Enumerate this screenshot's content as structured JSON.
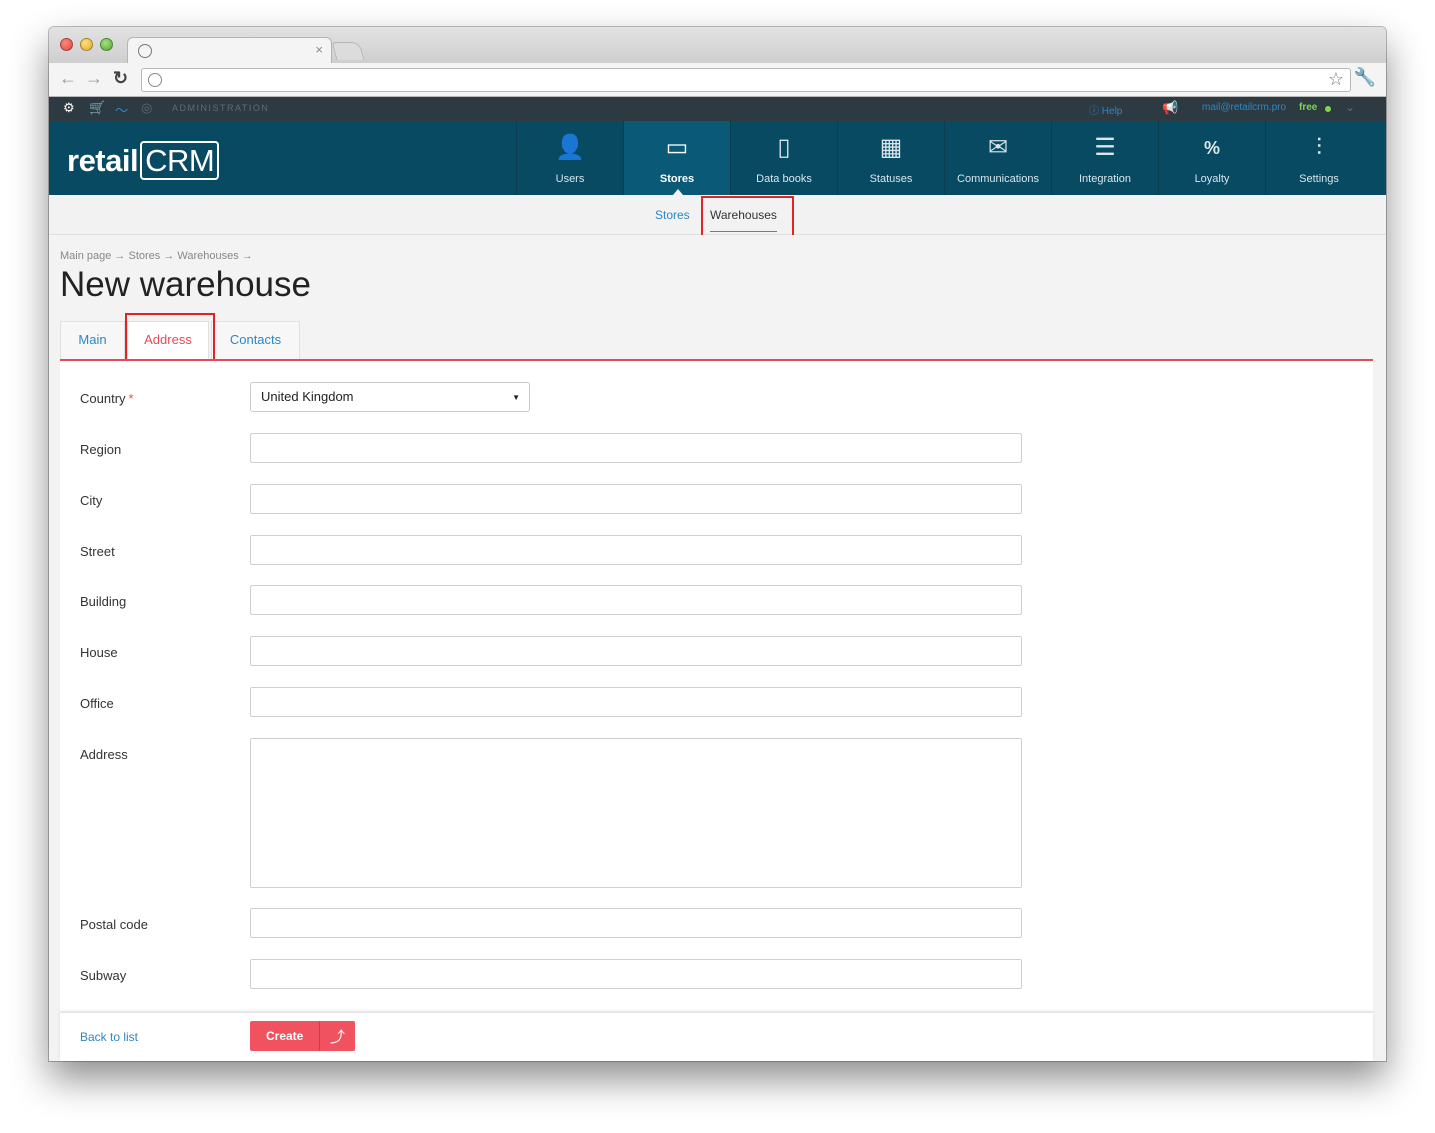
{
  "browser": {
    "tab_close": "×",
    "back_glyph": "←",
    "forward_glyph": "→",
    "reload_glyph": "↻",
    "star_glyph": "☆",
    "wrench_glyph": "🔧"
  },
  "adminbar": {
    "label": "ADMINISTRATION",
    "help": "Help",
    "email": "mail@retailcrm.pro",
    "plan": "free",
    "icons": [
      "gear-icon",
      "cart-icon",
      "chart-icon",
      "target-icon"
    ]
  },
  "logo": {
    "retail": "retail",
    "crm": "CRM"
  },
  "nav": [
    {
      "label": "Users",
      "icon": "👤"
    },
    {
      "label": "Stores",
      "icon": "▭"
    },
    {
      "label": "Data books",
      "icon": "▯"
    },
    {
      "label": "Statuses",
      "icon": "▦"
    },
    {
      "label": "Communications",
      "icon": "✉"
    },
    {
      "label": "Integration",
      "icon": "☰"
    },
    {
      "label": "Loyalty",
      "icon": "%"
    },
    {
      "label": "Settings",
      "icon": "⫶"
    }
  ],
  "subnav": {
    "stores": "Stores",
    "warehouses": "Warehouses"
  },
  "breadcrumb": "Main page → Stores → Warehouses →",
  "page_title": "New warehouse",
  "tabs": {
    "main": "Main",
    "address": "Address",
    "contacts": "Contacts"
  },
  "form": {
    "country_label": "Country",
    "required_mark": "*",
    "country_value": "United Kingdom",
    "region_label": "Region",
    "city_label": "City",
    "street_label": "Street",
    "building_label": "Building",
    "house_label": "House",
    "office_label": "Office",
    "address_label": "Address",
    "postal_label": "Postal code",
    "subway_label": "Subway"
  },
  "footer": {
    "back": "Back to list",
    "create": "Create",
    "create_icon": "⤴"
  }
}
